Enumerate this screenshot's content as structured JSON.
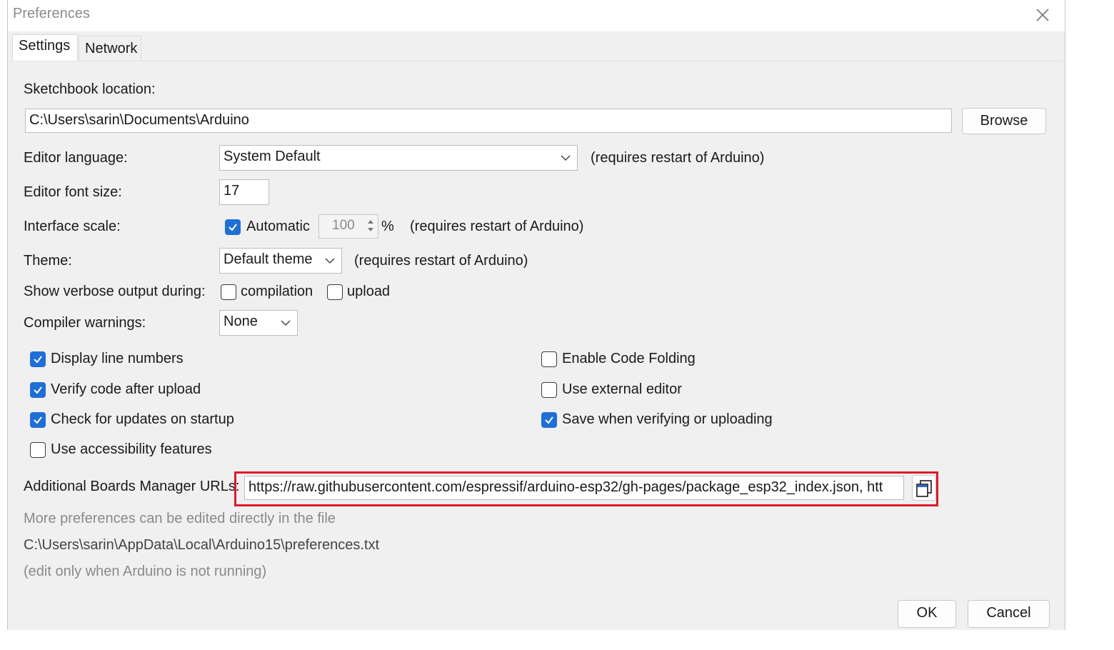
{
  "window": {
    "title": "Preferences"
  },
  "tabs": [
    {
      "label": "Settings",
      "active": true
    },
    {
      "label": "Network",
      "active": false
    }
  ],
  "sketchbook": {
    "label": "Sketchbook location:",
    "value": "C:\\Users\\sarin\\Documents\\Arduino",
    "browse_label": "Browse"
  },
  "editor_language": {
    "label": "Editor language:",
    "value": "System Default",
    "note": "(requires restart of Arduino)"
  },
  "editor_font_size": {
    "label": "Editor font size:",
    "value": "17"
  },
  "interface_scale": {
    "label": "Interface scale:",
    "automatic_label": "Automatic",
    "automatic_checked": true,
    "value": "100",
    "unit": "%",
    "note": "(requires restart of Arduino)"
  },
  "theme": {
    "label": "Theme:",
    "value": "Default theme",
    "note": "(requires restart of Arduino)"
  },
  "verbose": {
    "label": "Show verbose output during:",
    "compilation_label": "compilation",
    "compilation_checked": false,
    "upload_label": "upload",
    "upload_checked": false
  },
  "compiler_warnings": {
    "label": "Compiler warnings:",
    "value": "None"
  },
  "options_left": [
    {
      "label": "Display line numbers",
      "checked": true
    },
    {
      "label": "Verify code after upload",
      "checked": true
    },
    {
      "label": "Check for updates on startup",
      "checked": true
    },
    {
      "label": "Use accessibility features",
      "checked": false
    }
  ],
  "options_right": [
    {
      "label": "Enable Code Folding",
      "checked": false
    },
    {
      "label": "Use external editor",
      "checked": false
    },
    {
      "label": "Save when verifying or uploading",
      "checked": true
    }
  ],
  "boards_manager": {
    "label": "Additional Boards Manager URLs:",
    "value": "https://raw.githubusercontent.com/espressif/arduino-esp32/gh-pages/package_esp32_index.json, htt",
    "highlight_color": "#e0182b"
  },
  "info": {
    "line1": "More preferences can be edited directly in the file",
    "path": "C:\\Users\\sarin\\AppData\\Local\\Arduino15\\preferences.txt",
    "line3": "(edit only when Arduino is not running)"
  },
  "footer": {
    "ok_label": "OK",
    "cancel_label": "Cancel"
  },
  "colors": {
    "checkbox_checked": "#1f6fd6",
    "dialog_bg": "#f0f0f0"
  }
}
